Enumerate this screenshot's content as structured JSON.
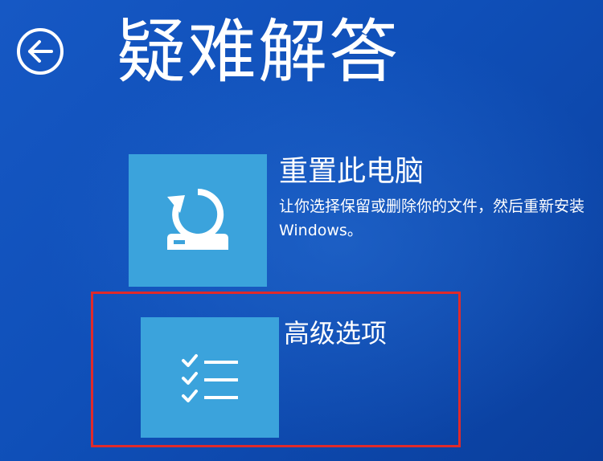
{
  "header": {
    "title": "疑难解答",
    "back_icon": "back-arrow-circle-icon"
  },
  "options": [
    {
      "id": "reset-pc",
      "icon": "reset-pc-icon",
      "title": "重置此电脑",
      "description": "让你选择保留或删除你的文件，然后重新安装 Windows。"
    },
    {
      "id": "advanced-options",
      "icon": "checklist-icon",
      "title": "高级选项",
      "description": ""
    }
  ],
  "colors": {
    "background": "#1256c0",
    "tile": "#3ba3dc",
    "highlight": "#e02a2a",
    "text": "#ffffff"
  }
}
